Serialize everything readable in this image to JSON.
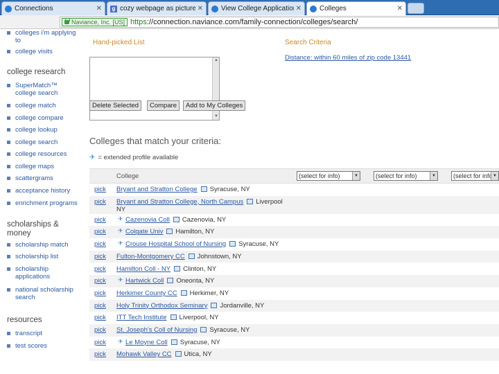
{
  "browser": {
    "tabs": [
      {
        "label": "Connections",
        "active": false
      },
      {
        "label": "cozy webpage as picture for",
        "active": false
      },
      {
        "label": "View College Applications",
        "active": false
      },
      {
        "label": "Colleges",
        "active": true
      }
    ],
    "secure_label": "Naviance, Inc. [US]",
    "url_proto": "https",
    "url_rest": "://connection.naviance.com/family-connection/colleges/search/"
  },
  "sidebar": {
    "top_links": [
      "colleges i'm applying to",
      "college visits"
    ],
    "sections": [
      {
        "heading": "college research",
        "links": [
          "SuperMatch™ college search",
          "college match",
          "college compare",
          "college lookup",
          "college search",
          "college resources",
          "college maps",
          "scattergrams",
          "acceptance history",
          "enrichment programs"
        ]
      },
      {
        "heading": "scholarships & money",
        "links": [
          "scholarship match",
          "scholarship list",
          "scholarship applications",
          "national scholarship search"
        ]
      },
      {
        "heading": "resources",
        "links": [
          "transcript",
          "test scores"
        ]
      }
    ]
  },
  "main": {
    "hand_picked_title": "Hand-picked List",
    "buttons": {
      "delete": "Delete Selected",
      "compare": "Compare",
      "add": "Add to My Colleges"
    },
    "criteria_title": "Search Criteria",
    "criteria_link": "Distance: within 60 miles of zip code 13441",
    "results_heading": "Colleges that match your criteria:",
    "legend_text": "= extended profile available",
    "table": {
      "college_header": "College",
      "select_options": [
        "(select for info)",
        "(select for info)",
        "(select for info)"
      ],
      "pick_label": "pick",
      "rows": [
        {
          "name": "Bryant and Stratton College",
          "city": "Syracuse, NY",
          "star": false
        },
        {
          "name": "Bryant and Stratton College, North Campus",
          "city": "Liverpool NY",
          "star": false
        },
        {
          "name": "Cazenovia Coll",
          "city": "Cazenovia, NY",
          "star": true
        },
        {
          "name": "Colgate Univ",
          "city": "Hamilton, NY",
          "star": true
        },
        {
          "name": "Crouse Hospital School of Nursing",
          "city": "Syracuse, NY",
          "star": true
        },
        {
          "name": "Fulton-Montgomery CC",
          "city": "Johnstown, NY",
          "star": false
        },
        {
          "name": "Hamilton Coll - NY",
          "city": "Clinton, NY",
          "star": false
        },
        {
          "name": "Hartwick Coll",
          "city": "Oneonta, NY",
          "star": true
        },
        {
          "name": "Herkimer County CC",
          "city": "Herkimer, NY",
          "star": false
        },
        {
          "name": "Holy Trinity Orthodox Seminary",
          "city": "Jordanville, NY",
          "star": false
        },
        {
          "name": "ITT Tech Institute",
          "city": "Liverpool, NY",
          "star": false
        },
        {
          "name": "St. Joseph's Coll of Nursing",
          "city": "Syracuse, NY",
          "star": false
        },
        {
          "name": "Le Moyne Coll",
          "city": "Syracuse, NY",
          "star": true
        },
        {
          "name": "Mohawk Valley CC",
          "city": "Utica, NY",
          "star": false
        }
      ]
    }
  }
}
